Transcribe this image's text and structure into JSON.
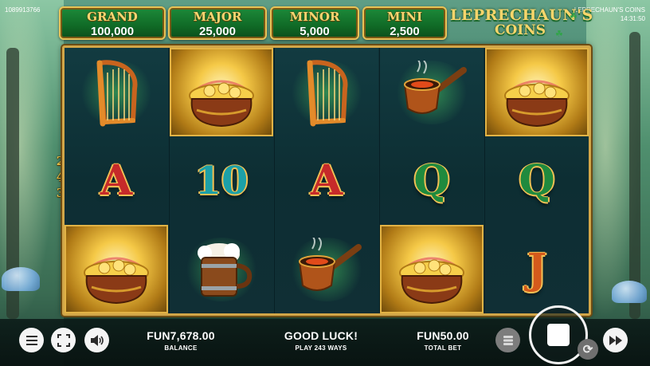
{
  "header": {
    "round_id": "1089913766",
    "game_name": "LEPRECHAUN'S COINS",
    "clock": "14:31:50"
  },
  "jackpots": [
    {
      "name": "GRAND",
      "value": "100,000"
    },
    {
      "name": "MAJOR",
      "value": "25,000"
    },
    {
      "name": "MINOR",
      "value": "5,000"
    },
    {
      "name": "MINI",
      "value": "2,500"
    }
  ],
  "logo": {
    "line1": "LEPRECHAUN'S",
    "line2": "COINS"
  },
  "ways_indicator": {
    "digits": [
      "2",
      "4",
      "3"
    ]
  },
  "reels": [
    [
      "harp-icon",
      "letter-a",
      "pot-of-gold-icon"
    ],
    [
      "pot-of-gold-icon",
      "number-10",
      "beer-mug-icon"
    ],
    [
      "harp-icon",
      "letter-a",
      "pipe-icon"
    ],
    [
      "pipe-icon",
      "letter-q",
      "pot-of-gold-icon"
    ],
    [
      "pot-of-gold-icon",
      "letter-q",
      "letter-j"
    ]
  ],
  "symbols_text": {
    "a": "A",
    "ten": "10",
    "q": "Q",
    "j": "J"
  },
  "bottom": {
    "balance_value": "FUN7,678.00",
    "balance_label": "BALANCE",
    "message": "GOOD LUCK!",
    "ways_label": "PLAY 243 WAYS",
    "bet_value": "FUN50.00",
    "bet_label": "TOTAL BET"
  },
  "colors": {
    "frame_gold": "#d2a648",
    "jackpot_green": "#106a26",
    "reel_bg": "#0f3036",
    "text_gold": "#f6d571"
  }
}
